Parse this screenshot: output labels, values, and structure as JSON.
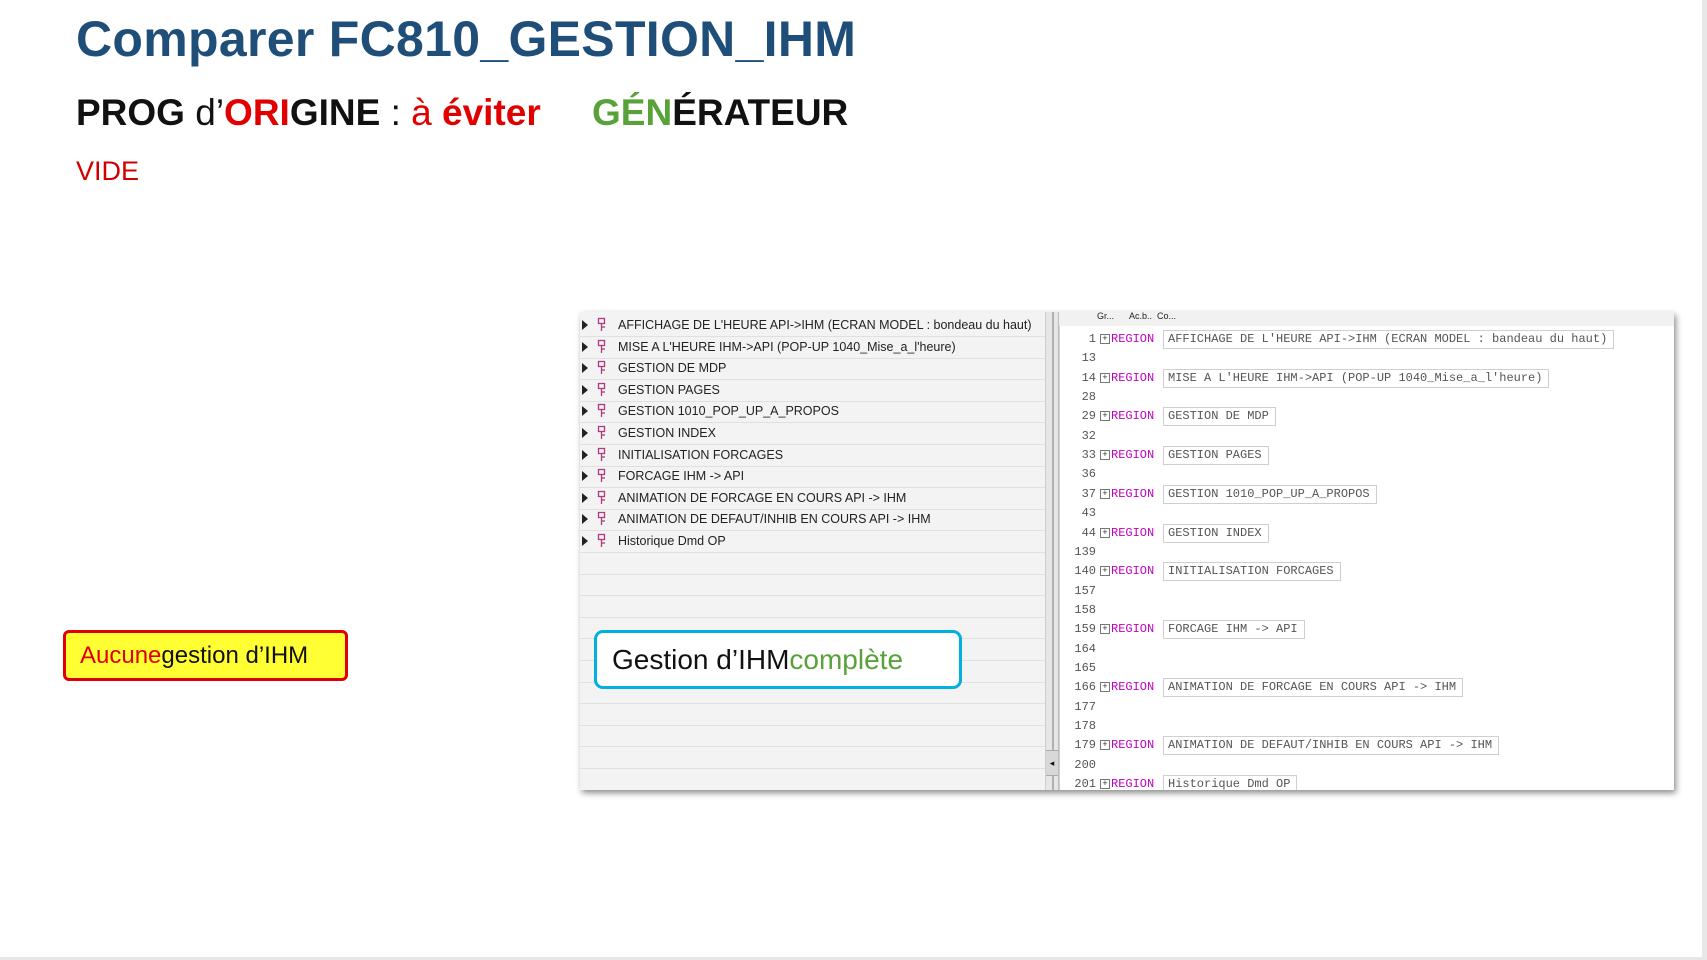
{
  "slide": {
    "title": "Comparer FC810_GESTION_IHM",
    "subtitle": {
      "prog": "PROG",
      "d": " d’",
      "ori": "ORI",
      "gine": "GINE",
      "colon": " : ",
      "a": "à",
      "space": " ",
      "eviter": "éviter"
    },
    "generator": {
      "gen": "GÉN",
      "erateur": "ÉRATEUR"
    },
    "vide_label": "VIDE",
    "left_callout": {
      "part1": "Aucune",
      "part2": " gestion d’IHM"
    },
    "right_callout": {
      "part1": "Gestion d’IHM ",
      "part2": "complète"
    }
  },
  "screenshot": {
    "code_tabs": [
      "Gr...",
      "Ac.b..",
      "Co..."
    ],
    "tree_items": [
      {
        "label": "AFFICHAGE DE L'HEURE API->IHM  (ECRAN MODEL : bondeau du haut)"
      },
      {
        "label": "MISE A L'HEURE IHM->API (POP-UP 1040_Mise_a_l'heure)"
      },
      {
        "label": "GESTION DE MDP"
      },
      {
        "label": "GESTION PAGES"
      },
      {
        "label": "GESTION 1010_POP_UP_A_PROPOS"
      },
      {
        "label": "GESTION INDEX"
      },
      {
        "label": "INITIALISATION FORCAGES"
      },
      {
        "label": "FORCAGE IHM -> API"
      },
      {
        "label": "ANIMATION DE FORCAGE EN COURS API -> IHM"
      },
      {
        "label": "ANIMATION DE DEFAUT/INHIB EN COURS API -> IHM"
      },
      {
        "label": "Historique Dmd OP"
      }
    ],
    "code_lines": [
      {
        "ln": "1",
        "region": true,
        "text": "AFFICHAGE DE L'HEURE API->IHM  (ECRAN MODEL : bandeau du haut)"
      },
      {
        "ln": "13",
        "region": false,
        "text": ""
      },
      {
        "ln": "14",
        "region": true,
        "text": "MISE A L'HEURE IHM->API (POP-UP 1040_Mise_a_l'heure)"
      },
      {
        "ln": "28",
        "region": false,
        "text": ""
      },
      {
        "ln": "29",
        "region": true,
        "text": "GESTION DE MDP"
      },
      {
        "ln": "32",
        "region": false,
        "text": ""
      },
      {
        "ln": "33",
        "region": true,
        "text": "GESTION PAGES"
      },
      {
        "ln": "36",
        "region": false,
        "text": ""
      },
      {
        "ln": "37",
        "region": true,
        "text": "GESTION 1010_POP_UP_A_PROPOS"
      },
      {
        "ln": "43",
        "region": false,
        "text": ""
      },
      {
        "ln": "44",
        "region": true,
        "text": "GESTION INDEX"
      },
      {
        "ln": "139",
        "region": false,
        "text": ""
      },
      {
        "ln": "140",
        "region": true,
        "text": "INITIALISATION FORCAGES"
      },
      {
        "ln": "157",
        "region": false,
        "text": ""
      },
      {
        "ln": "158",
        "region": false,
        "text": ""
      },
      {
        "ln": "159",
        "region": true,
        "text": "FORCAGE IHM -> API"
      },
      {
        "ln": "164",
        "region": false,
        "text": ""
      },
      {
        "ln": "165",
        "region": false,
        "text": ""
      },
      {
        "ln": "166",
        "region": true,
        "text": "ANIMATION DE FORCAGE EN COURS API -> IHM"
      },
      {
        "ln": "177",
        "region": false,
        "text": ""
      },
      {
        "ln": "178",
        "region": false,
        "text": ""
      },
      {
        "ln": "179",
        "region": true,
        "text": "ANIMATION DE DEFAUT/INHIB EN COURS API -> IHM"
      },
      {
        "ln": "200",
        "region": false,
        "text": ""
      },
      {
        "ln": "201",
        "region": true,
        "text": "Historique Dmd OP"
      }
    ],
    "region_keyword": "REGION",
    "expand_glyph": "+",
    "splitter_glyph": "◂"
  },
  "colors": {
    "title": "#1f4e79",
    "red": "#e00000",
    "green": "#59a23a",
    "region_keyword": "#c000c0",
    "callout_yellow_bg": "#ffff33",
    "callout_blue_border": "#00b0e0"
  },
  "icons": [
    "expand-arrow-icon",
    "region-icon",
    "collapse-plus-icon"
  ]
}
